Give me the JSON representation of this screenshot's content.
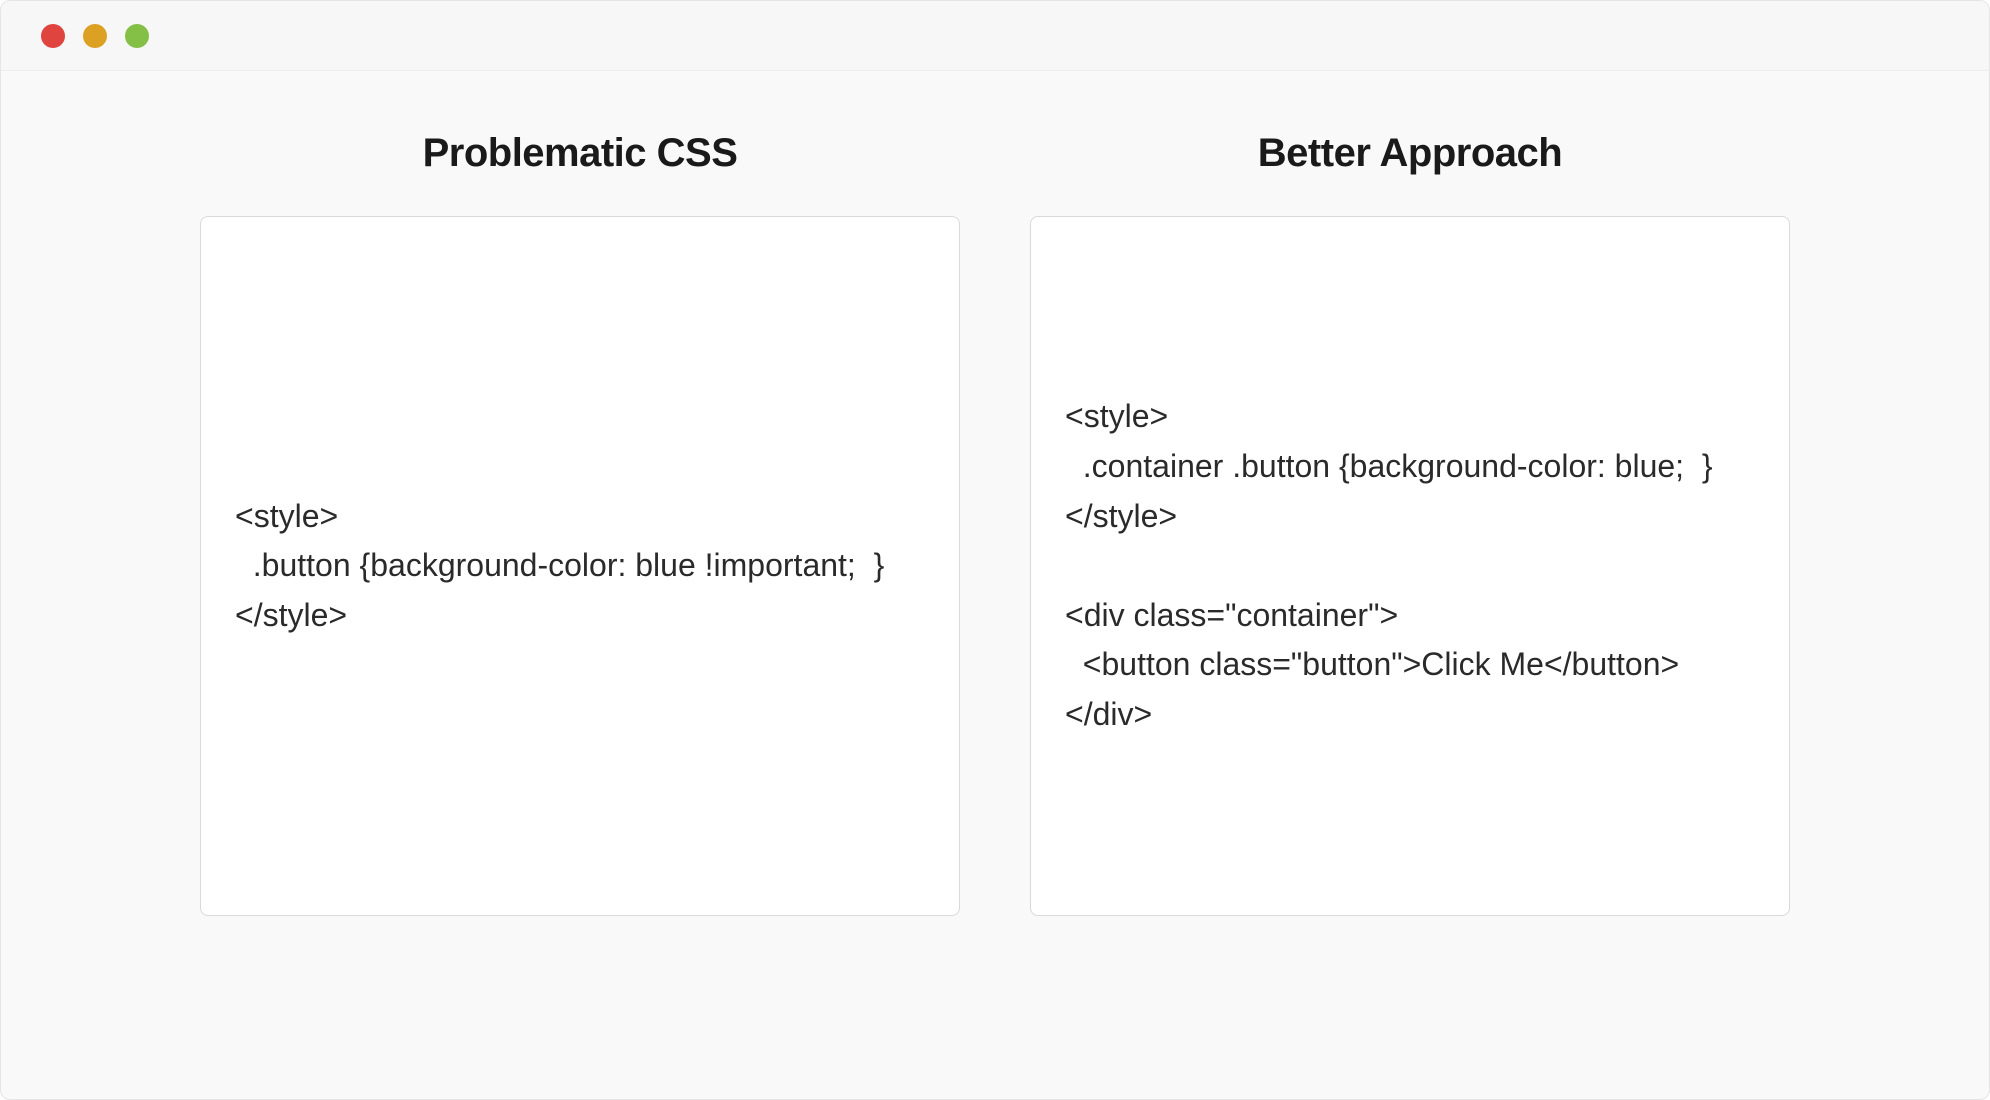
{
  "left": {
    "heading": "Problematic CSS",
    "code": "<style>\n  .button {background-color: blue !important;  }\n</style>"
  },
  "right": {
    "heading": "Better Approach",
    "code": "<style>\n  .container .button {background-color: blue;  }\n</style>\n\n<div class=\"container\">\n  <button class=\"button\">Click Me</button>\n</div>"
  }
}
